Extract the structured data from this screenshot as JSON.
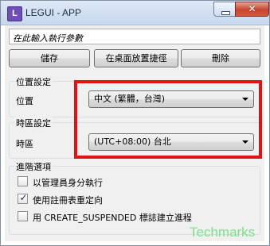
{
  "window": {
    "title": "LEGUI - APP",
    "icon_letter": "L"
  },
  "args_input": {
    "placeholder": "在此輸入執行參數"
  },
  "toolbar": {
    "save_label": "儲存",
    "shortcut_label": "在桌面放置捷徑",
    "delete_label": "刪除"
  },
  "location_group": {
    "title": "位置設定",
    "field_label": "位置",
    "selected": "中文 (繁體，台灣)"
  },
  "timezone_group": {
    "title": "時區設定",
    "field_label": "時區",
    "selected": "(UTC+08:00) 台北"
  },
  "advanced_group": {
    "title": "進階選項",
    "options": [
      {
        "label": "以管理員身分執行",
        "checked": false
      },
      {
        "label": "使用註冊表重定向",
        "checked": true
      },
      {
        "label": "用 CREATE_SUSPENDED 標誌建立進程",
        "checked": false
      }
    ]
  },
  "watermark": "Techmarks",
  "colors": {
    "highlight_box": "#e21212",
    "watermark": "#7fe08c"
  }
}
